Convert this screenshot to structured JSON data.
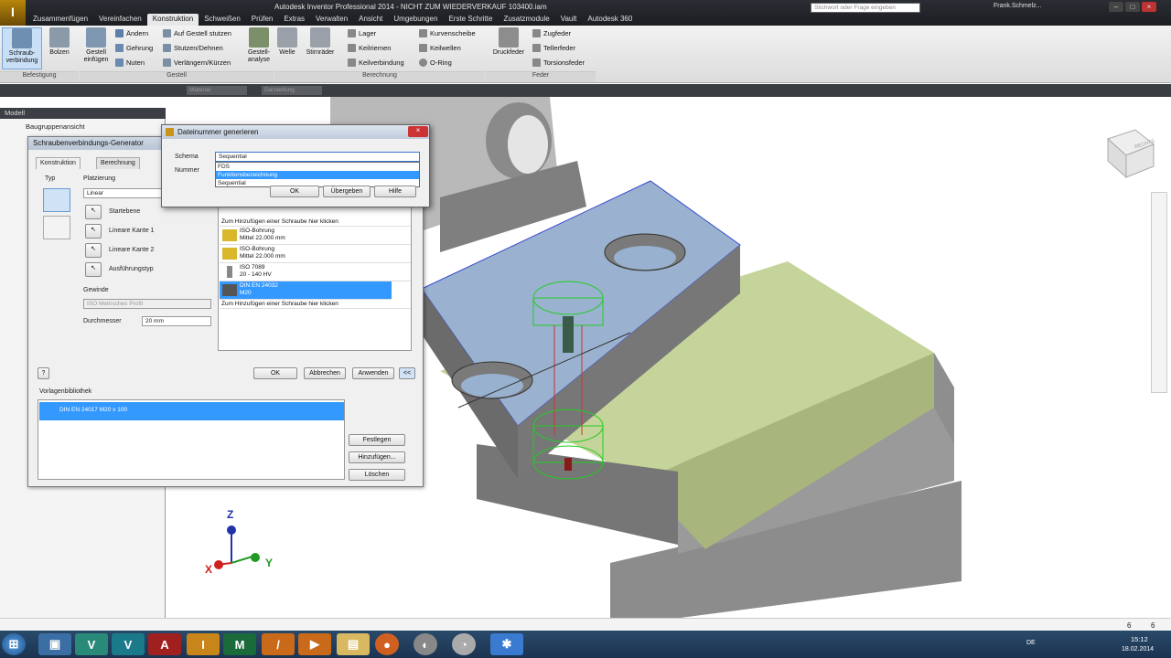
{
  "app": {
    "title": "Autodesk Inventor Professional 2014 - NICHT ZUM WIEDERVERKAUF   103400.iam",
    "search_placeholder": "Stichwort oder Frage eingeben",
    "user": "Frank.Schmelz..."
  },
  "ribbon_tabs": [
    "Zusammenfügen",
    "Vereinfachen",
    "Konstruktion",
    "Schweißen",
    "Prüfen",
    "Extras",
    "Verwalten",
    "Ansicht",
    "Umgebungen",
    "Erste Schritte",
    "Zusatzmodule",
    "Vault",
    "Autodesk 360"
  ],
  "ribbon": {
    "schraubverbindung": "Schraub-\nverbindung",
    "bolzen": "Bolzen",
    "gestell_einfuegen": "Gestell\neinfügen",
    "aendern": "Ändern",
    "gehrung": "Gehrung",
    "nuten": "Nuten",
    "auf_gestell_stutzen": "Auf Gestell stutzen",
    "stutzen_dehnen": "Stutzen/Dehnen",
    "verlaengern_kuerzen": "Verlängern/Kürzen",
    "gestell_analyse": "Gestell-\nanalyse",
    "welle": "Welle",
    "stirnraeder": "Stirnräder",
    "lager": "Lager",
    "keilriemen": "Keilriemen",
    "keilverbindung": "Keilverbindung",
    "kurvenscheibe": "Kurvenscheibe",
    "keilwellen": "Keilwellen",
    "o_ring": "O-Ring",
    "druckfeder": "Druckfeder",
    "zugfeder": "Zugfeder",
    "tellerfeder": "Tellerfeder",
    "torsionsfeder": "Torsionsfeder",
    "grp_befestigung": "Befestigung",
    "grp_gestell": "Gestell",
    "grp_berechnung": "Berechnung",
    "grp_feder": "Feder"
  },
  "qat": {
    "material": "Material",
    "darstellung": "Darstellung"
  },
  "browser": {
    "header": "Modell",
    "view": "Baugruppenansicht"
  },
  "generator": {
    "title": "Schraubenverbindungs-Generator",
    "tab_konstruktion": "Konstruktion",
    "tab_berechnung": "Berechnung",
    "typ": "Typ",
    "platzierung": "Platzierung",
    "linear": "Linear",
    "startebene": "Startebene",
    "lineare_kante_1": "Lineare Kante 1",
    "lineare_kante_2": "Lineare Kante 2",
    "ausfuehrungstyp": "Ausführungstyp",
    "gewinde": "Gewinde",
    "gewinde_value": "ISO Metrisches Profil",
    "durchmesser": "Durchmesser",
    "durchmesser_value": "20 mm",
    "list_add_top": "Zum Hinzufügen einer Schraube hier klicken",
    "list_items": [
      {
        "l1": "ISO-Bohrung",
        "l2": "Mittel 22.000 mm"
      },
      {
        "l1": "ISO-Bohrung",
        "l2": "Mittel 22.000 mm"
      },
      {
        "l1": "ISO 7089",
        "l2": "20 - 140 HV"
      },
      {
        "l1": "DIN EN 24032",
        "l2": "M20"
      }
    ],
    "list_add_bottom": "Zum Hinzufügen einer Schraube hier klicken",
    "ok": "OK",
    "abbrechen": "Abbrechen",
    "anwenden": "Anwenden",
    "expand": "<<",
    "vorlagenbibliothek": "Vorlagenbibliothek",
    "template_item": "DIN EN 24017 M20 x 100",
    "festlegen": "Festlegen",
    "hinzufuegen": "Hinzufügen...",
    "loeschen": "Löschen"
  },
  "dateinummer": {
    "title": "Dateinummer generieren",
    "schema": "Schema",
    "nummer": "Nummer",
    "selected": "Sequential",
    "options": [
      "FDS",
      "Funktionsbezeichnung",
      "Sequential"
    ],
    "ok": "OK",
    "uebergeben": "Übergeben",
    "hilfe": "Hilfe"
  },
  "viewport": {
    "viewcube": "RECHTS",
    "axis_x": "X",
    "axis_y": "Y",
    "axis_z": "Z"
  },
  "status": {
    "right1": "6",
    "right2": "6"
  },
  "taskbar": {
    "lang": "DE",
    "time": "15:12",
    "date": "18.02.2014"
  }
}
